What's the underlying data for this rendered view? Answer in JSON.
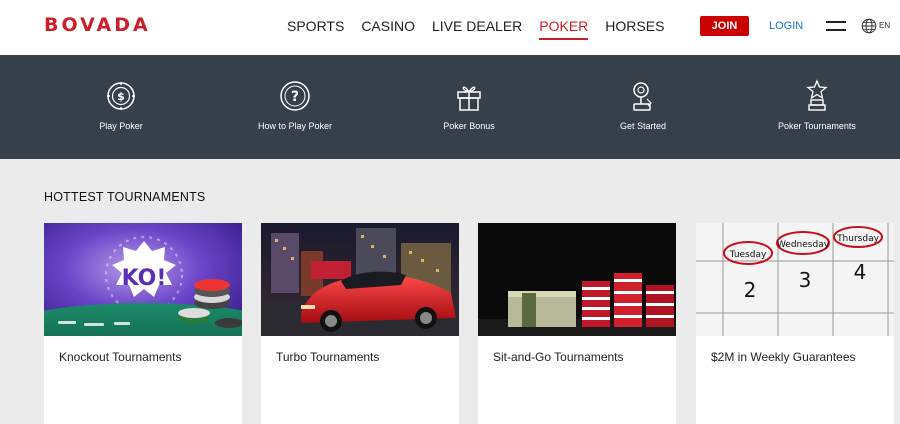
{
  "header": {
    "logo": "BOVADA",
    "nav": [
      "SPORTS",
      "CASINO",
      "LIVE DEALER",
      "POKER",
      "HORSES"
    ],
    "active_nav": "POKER",
    "join_label": "JOIN",
    "login_label": "LOGIN",
    "lang": "EN"
  },
  "subnav": {
    "items": [
      {
        "label": "Play Poker",
        "icon": "poker-chip-dollar-icon"
      },
      {
        "label": "How to Play Poker",
        "icon": "question-mark-icon"
      },
      {
        "label": "Poker Bonus",
        "icon": "gift-icon"
      },
      {
        "label": "Get Started",
        "icon": "joystick-icon"
      },
      {
        "label": "Poker Tournaments",
        "icon": "trophy-star-icon"
      }
    ]
  },
  "section": {
    "title": "HOTTEST TOURNAMENTS"
  },
  "cards": [
    {
      "title": "Knockout Tournaments",
      "badge": "KO!"
    },
    {
      "title": "Turbo Tournaments"
    },
    {
      "title": "Sit-and-Go Tournaments"
    },
    {
      "title": "$2M in Weekly Guarantees",
      "calendar_days": [
        "Tuesday",
        "Wednesday",
        "Thursday"
      ],
      "calendar_nums": [
        "2",
        "3",
        "4"
      ]
    }
  ],
  "colors": {
    "brand": "#cc1f2b",
    "subnav_bg": "#36404b",
    "page_bg": "#ebebeb"
  }
}
